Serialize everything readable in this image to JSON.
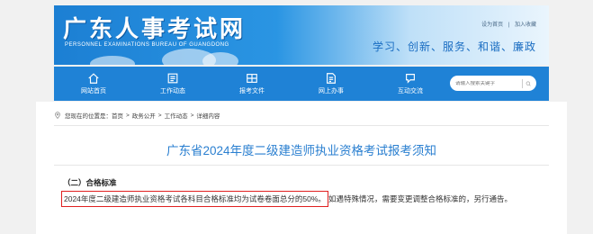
{
  "header": {
    "site_title": "广东人事考试网",
    "site_subtitle": "PERSONNEL EXAMINATIONS BUREAU OF GUANGDONG",
    "top_links": [
      "设为首页",
      "|",
      "加入收藏"
    ],
    "slogan": "学习、创新、服务、和谐、廉政"
  },
  "nav": {
    "items": [
      {
        "label": "网站首页",
        "icon": "home-icon"
      },
      {
        "label": "工作动态",
        "icon": "news-icon"
      },
      {
        "label": "报考文件",
        "icon": "document-icon"
      },
      {
        "label": "网上办事",
        "icon": "online-service-icon"
      },
      {
        "label": "互动交流",
        "icon": "chat-icon"
      }
    ],
    "search_placeholder": "请输入搜索关键字"
  },
  "breadcrumb": {
    "prefix": "您现在的位置是：",
    "items": [
      "首页",
      "政务公开",
      "工作动态",
      "详细内容"
    ],
    "separator": ">"
  },
  "article": {
    "title": "广东省2024年度二级建造师执业资格考试报考须知",
    "section_heading": "（二）合格标准",
    "highlighted_text": "2024年度二级建造师执业资格考试各科目合格标准均为试卷卷面总分的50%。",
    "rest_text": "如遇特殊情况，需要变更调整合格标准的，另行通告。"
  },
  "colors": {
    "nav_bg": "#1f82d6",
    "title_color": "#2a7fd0",
    "highlight_border": "#e02020"
  }
}
